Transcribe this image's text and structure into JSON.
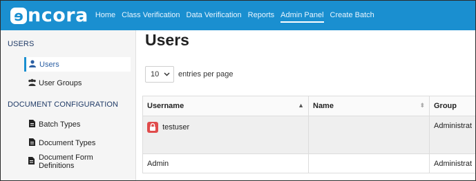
{
  "navbar": {
    "logo_mark": "ɘ",
    "logo_text": "ncora",
    "links": [
      "Home",
      "Class Verification",
      "Data Verification",
      "Reports",
      "Admin Panel",
      "Create Batch"
    ],
    "active": "Admin Panel",
    "color": "#1a8fd0"
  },
  "sidebar": {
    "section_users": "USERS",
    "users_items": [
      {
        "label": "Users",
        "icon": "user-icon",
        "active": true
      },
      {
        "label": "User Groups",
        "icon": "users-icon",
        "active": false
      }
    ],
    "section_docs": "DOCUMENT CONFIGURATION",
    "doc_items": [
      {
        "label": "Batch Types",
        "icon": "file-icon"
      },
      {
        "label": "Document Types",
        "icon": "file-icon"
      },
      {
        "label": "Document Form Definitions",
        "icon": "file-icon"
      }
    ]
  },
  "main": {
    "title": "Users",
    "entries_value": "10",
    "entries_label": "entries per page",
    "table": {
      "columns": [
        "Username",
        "Name",
        "Group"
      ],
      "rows": [
        {
          "username": "testuser",
          "name": "",
          "group": "Administrat",
          "locked": true
        },
        {
          "username": "Admin",
          "name": "",
          "group": "Administrat",
          "locked": false
        }
      ]
    }
  }
}
